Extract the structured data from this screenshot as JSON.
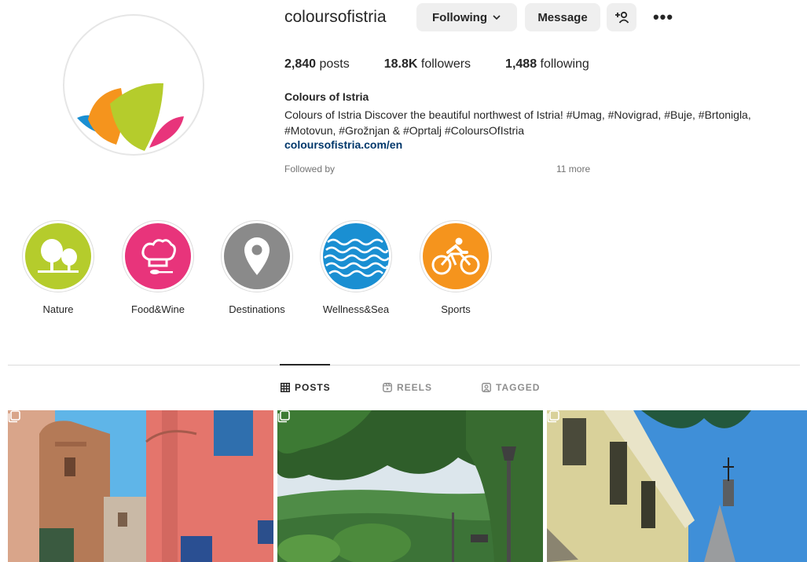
{
  "profile": {
    "username": "coloursofistria",
    "following_button": "Following",
    "message_button": "Message",
    "stats": {
      "posts_count": "2,840",
      "posts_label": "posts",
      "followers_count": "18.8K",
      "followers_label": "followers",
      "following_count": "1,488",
      "following_label": "following"
    },
    "full_name": "Colours of Istria",
    "bio": "Colours of Istria Discover the beautiful northwest of Istria! #Umag, #Novigrad, #Buje, #Brtonigla, #Motovun, #Grožnjan & #Oprtalj #ColoursOfIstria",
    "link": "coloursofistria.com/en",
    "followed_by": "Followed by ",
    "followed_more": "11 more"
  },
  "highlights": [
    {
      "label": "Nature",
      "color": "#b5cc2c",
      "icon": "trees-icon"
    },
    {
      "label": "Food&Wine",
      "color": "#e8347b",
      "icon": "chef-hat-icon"
    },
    {
      "label": "Destinations",
      "color": "#8a8a8a",
      "icon": "map-pin-icon"
    },
    {
      "label": "Wellness&Sea",
      "color": "#1a8fd2",
      "icon": "waves-icon"
    },
    {
      "label": "Sports",
      "color": "#f5941d",
      "icon": "cyclist-icon"
    }
  ],
  "tabs": {
    "posts": "POSTS",
    "reels": "REELS",
    "tagged": "TAGGED"
  },
  "colors": {
    "logo_orange": "#f5941d",
    "logo_green": "#b5cc2c",
    "logo_pink": "#e8347b",
    "logo_blue": "#1a8fd2",
    "link": "#00376b"
  }
}
